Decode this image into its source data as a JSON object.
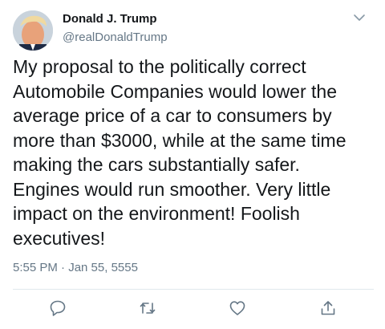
{
  "user": {
    "name": "Donald J. Trump",
    "handle": "@realDonaldTrump"
  },
  "tweet": {
    "lines": [
      "My proposal to the politically correct",
      "Automobile Companies would lower the",
      "average price of a car to consumers by",
      "more than $3000, while at the same time",
      "making the cars substantially safer.",
      "Engines would run smoother. Very little",
      "impact on the environment! Foolish",
      "executives!"
    ],
    "timestamp": "5:55 PM · Jan 55, 5555"
  },
  "icons": {
    "menu": "chevron-down-icon",
    "reply": "reply-icon",
    "retweet": "retweet-icon",
    "like": "heart-icon",
    "share": "share-icon"
  },
  "colors": {
    "text": "#14171a",
    "secondary": "#657786",
    "divider": "#e1e8ed"
  }
}
